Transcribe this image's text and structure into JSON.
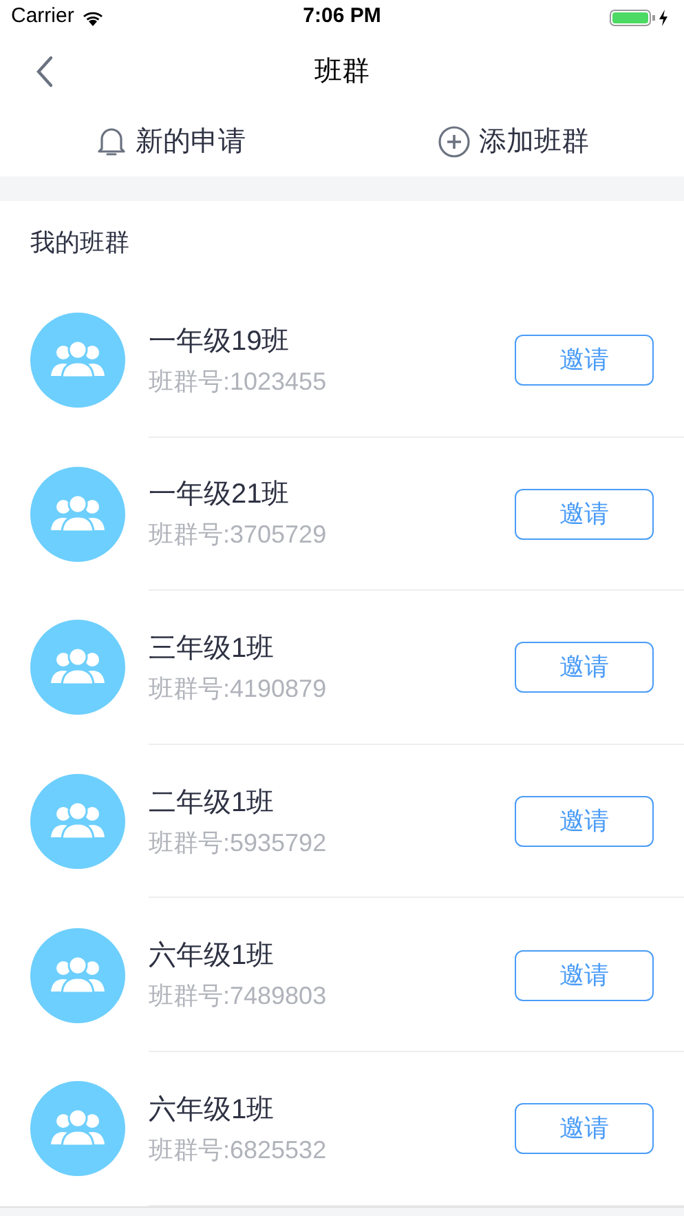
{
  "status_bar": {
    "carrier": "Carrier",
    "time": "7:06 PM"
  },
  "nav": {
    "title": "班群"
  },
  "actions": [
    {
      "label": "新的申请",
      "kind": "bell"
    },
    {
      "label": "添加班群",
      "kind": "add"
    }
  ],
  "section": {
    "title": "我的班群"
  },
  "groups": [
    {
      "name": "一年级19班",
      "number": "班群号:1023455",
      "button": "邀请"
    },
    {
      "name": "一年级21班",
      "number": "班群号:3705729",
      "button": "邀请"
    },
    {
      "name": "三年级1班",
      "number": "班群号:4190879",
      "button": "邀请"
    },
    {
      "name": "二年级1班",
      "number": "班群号:5935792",
      "button": "邀请"
    },
    {
      "name": "六年级1班",
      "number": "班群号:7489803",
      "button": "邀请"
    },
    {
      "name": "六年级1班",
      "number": "班群号:6825532",
      "button": "邀请"
    }
  ]
}
